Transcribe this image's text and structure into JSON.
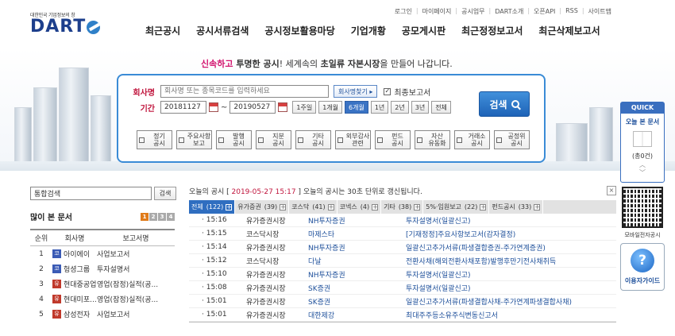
{
  "header": {
    "logo_tagline": "대한민국 기업정보의 창",
    "logo_text": "DART",
    "util_links": [
      "로그인",
      "마이페이지",
      "공시업무",
      "DART소개",
      "오픈API",
      "RSS",
      "사이트맵"
    ],
    "nav": [
      "최근공시",
      "공시서류검색",
      "공시정보활용마당",
      "기업개황",
      "공모게시판",
      "최근정정보고서",
      "최근삭제보고서"
    ]
  },
  "slogan": {
    "part1": "신속하고",
    "part2": " 투명한 공시",
    "part3": "! 세계속의 ",
    "part4": "초일류",
    "part5": " 자본시장",
    "part6": "을 만들어 나갑니다."
  },
  "search": {
    "company_label": "회사명",
    "company_placeholder": "회사명 또는 종목코드를 입력하세요",
    "company_find_btn": "회사명찾기 ▸",
    "latest_report_label": "최종보고서",
    "period_label": "기간",
    "start_date": "20181127",
    "end_date": "20190527",
    "periods": [
      "1주일",
      "1개월",
      "6개월",
      "1년",
      "2년",
      "3년",
      "전체"
    ],
    "active_period": "6개월",
    "submit_label": "검색",
    "categories": [
      [
        "정기",
        "공시"
      ],
      [
        "주요사항",
        "보고"
      ],
      [
        "발행",
        "공시"
      ],
      [
        "지분",
        "공시"
      ],
      [
        "기타",
        "공시"
      ],
      [
        "외부감사",
        "관련"
      ],
      [
        "펀드",
        "공시"
      ],
      [
        "자산",
        "유동화"
      ],
      [
        "거래소",
        "공시"
      ],
      [
        "공정위",
        "공시"
      ]
    ]
  },
  "quick": {
    "header": "QUICK",
    "title": "오늘 본 문서",
    "count": "(총0건)",
    "qr_label": "모바일전자공시",
    "guide_label": "이용자가이드"
  },
  "integrated_search": {
    "placeholder": "통합검색",
    "button": "검색"
  },
  "popular": {
    "title": "많이 본 문서",
    "pages": [
      "1",
      "2",
      "3",
      "4"
    ],
    "active_page": "1",
    "columns": [
      "순위",
      "회사명",
      "보고서명"
    ],
    "rows": [
      {
        "rank": "1",
        "mark": "코",
        "mark_color": "#3b5bb5",
        "company": "아이에이",
        "report": "사업보고서"
      },
      {
        "rank": "2",
        "mark": "코",
        "mark_color": "#3b5bb5",
        "company": "헝셩그룹",
        "report": "투자설명서"
      },
      {
        "rank": "3",
        "mark": "유",
        "mark_color": "#c0392b",
        "company": "현대중공업",
        "report": "영업(잠정)실적(공..."
      },
      {
        "rank": "4",
        "mark": "유",
        "mark_color": "#c0392b",
        "company": "현대미포...",
        "report": "영업(잠정)실적(공..."
      },
      {
        "rank": "5",
        "mark": "유",
        "mark_color": "#c0392b",
        "company": "삼성전자",
        "report": "사업보고서"
      }
    ]
  },
  "today": {
    "prefix": "오늘의 공시 [ ",
    "datetime": "2019-05-27 15:17",
    "suffix": " ] 오늘의 공시는 30초 단위로 갱신됩니다.",
    "tabs": [
      {
        "label": "전체",
        "count": "(122)"
      },
      {
        "label": "유가증권",
        "count": "(39)"
      },
      {
        "label": "코스닥",
        "count": "(41)"
      },
      {
        "label": "코넥스",
        "count": "(4)"
      },
      {
        "label": "기타",
        "count": "(38)"
      },
      {
        "label": "5%·임원보고",
        "count": "(22)"
      },
      {
        "label": "펀드공시",
        "count": "(33)"
      }
    ],
    "rows": [
      {
        "time": "· 15:16",
        "market": "유가증권시장",
        "company": "NH투자증권",
        "report": "투자설명서(일괄신고)"
      },
      {
        "time": "· 15:15",
        "market": "코스닥시장",
        "company": "마제스타",
        "report": "[기재정정]주요사항보고서(감자결정)"
      },
      {
        "time": "· 15:14",
        "market": "유가증권시장",
        "company": "NH투자증권",
        "report": "일괄신고추가서류(파생결합증권-주가연계증권)"
      },
      {
        "time": "· 15:12",
        "market": "코스닥시장",
        "company": "다날",
        "report": "전환사채(해외전환사채포함)발행후만기전사채취득"
      },
      {
        "time": "· 15:10",
        "market": "유가증권시장",
        "company": "NH투자증권",
        "report": "투자설명서(일괄신고)"
      },
      {
        "time": "· 15:08",
        "market": "유가증권시장",
        "company": "SK증권",
        "report": "투자설명서(일괄신고)"
      },
      {
        "time": "· 15:01",
        "market": "유가증권시장",
        "company": "SK증권",
        "report": "일괄신고추가서류(파생결합사채-주가연계파생결합사채)"
      },
      {
        "time": "· 15:01",
        "market": "유가증권시장",
        "company": "대한제강",
        "report": "최대주주등소유주식변동신고서"
      }
    ]
  }
}
